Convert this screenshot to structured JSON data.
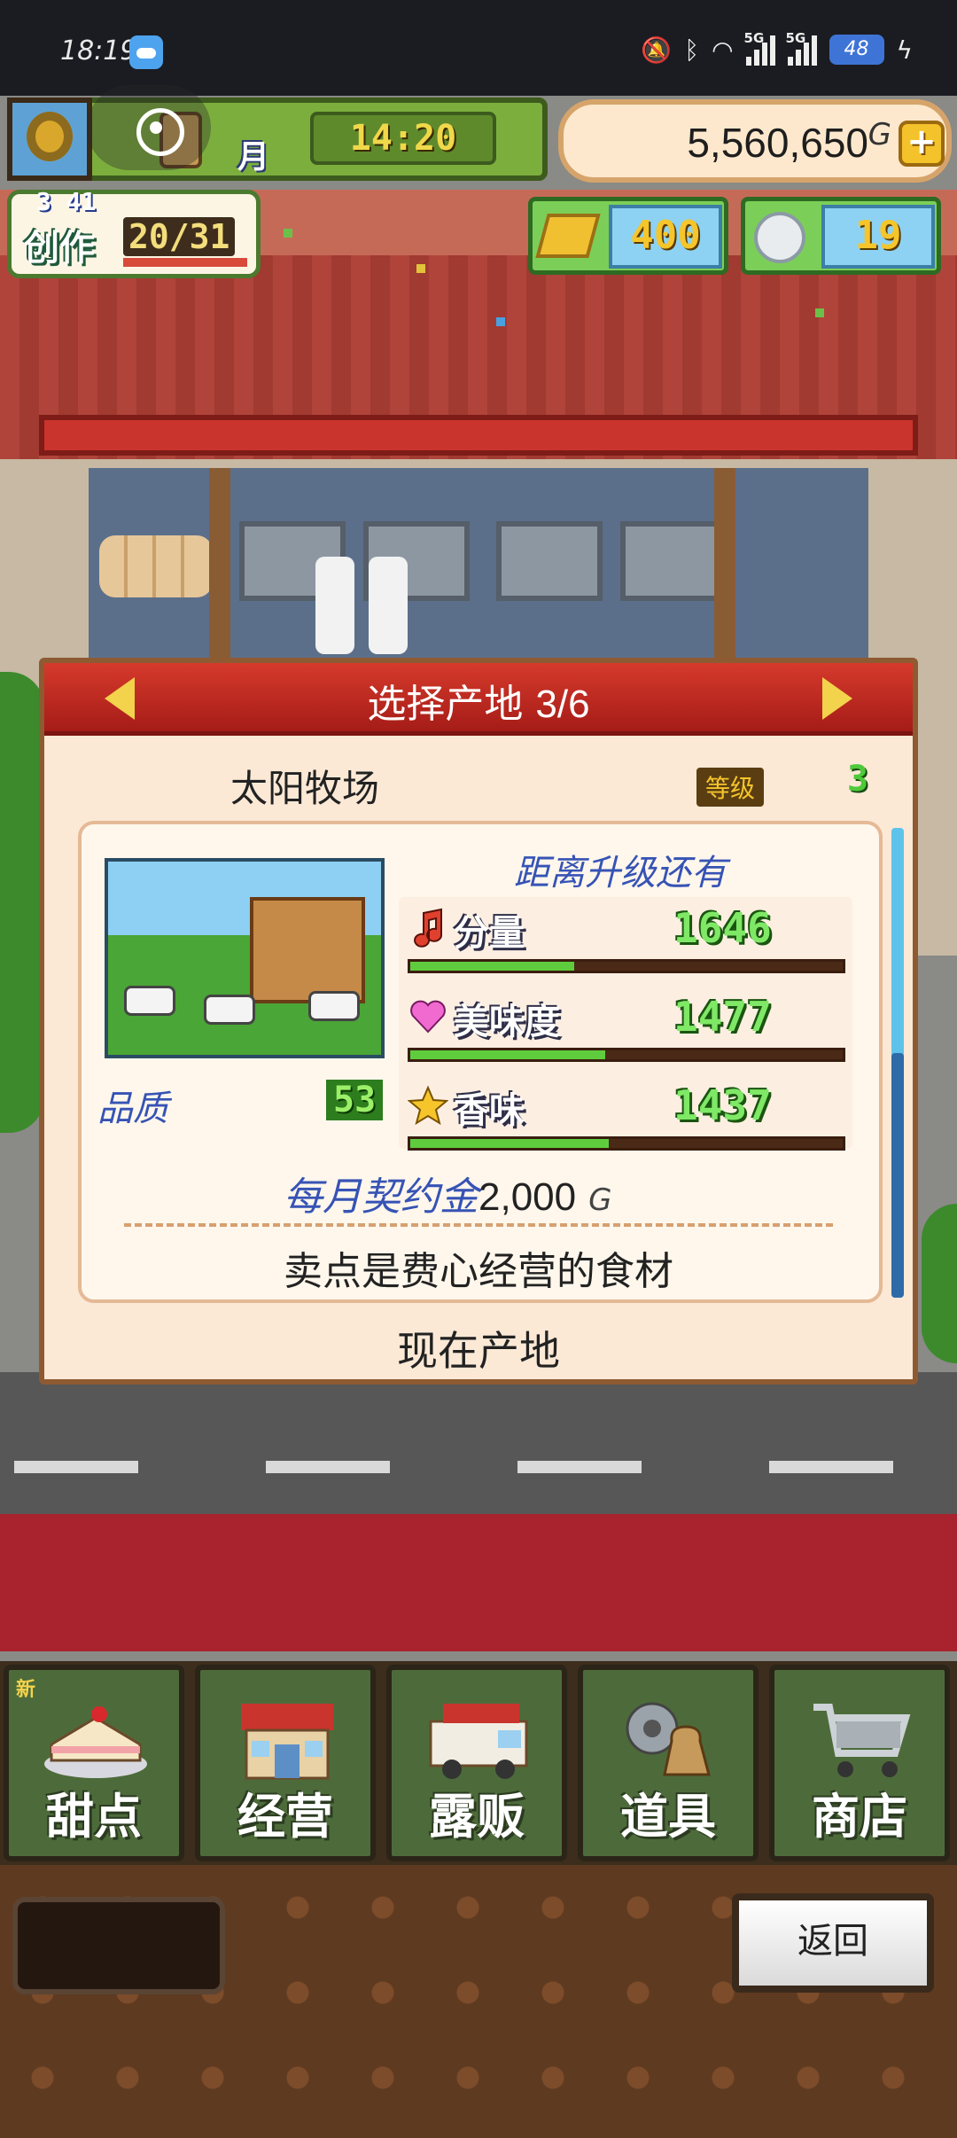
{
  "status_bar": {
    "time": "18:19",
    "network_1": "5G",
    "network_2": "5G",
    "battery": "48",
    "icons": [
      "weather-icon",
      "mute-icon",
      "bluetooth-icon",
      "wifi-icon",
      "signal-icon",
      "signal-icon",
      "battery-icon",
      "charging-icon"
    ]
  },
  "hud": {
    "month_label": "月",
    "clock": "14:20",
    "money": "5,560,650",
    "money_unit": "G",
    "plus": "+",
    "create_label": "创作",
    "create_rank": "3 41",
    "create_count": "20/31",
    "gold_count": "400",
    "medal_count": "19"
  },
  "dialog": {
    "title": "选择产地",
    "page": "3/6",
    "farm_name": "太阳牧场",
    "level_tag": "等级",
    "level": "3",
    "upgrade_label": "距离升级还有",
    "quality_label": "品质",
    "quality_value": "53",
    "stats": [
      {
        "name": "分量",
        "value": "1646",
        "icon": "music-note-icon",
        "progress": 0.38
      },
      {
        "name": "美味度",
        "value": "1477",
        "icon": "heart-icon",
        "progress": 0.45
      },
      {
        "name": "香味",
        "value": "1437",
        "icon": "star-icon",
        "progress": 0.46
      }
    ],
    "fee_label": "每月契约金",
    "fee_value": "2,000",
    "fee_unit": "G",
    "description": "卖点是费心经营的食材",
    "current_label": "现在产地"
  },
  "menu": {
    "items": [
      {
        "label": "甜点",
        "icon": "cake-icon",
        "new": "新"
      },
      {
        "label": "经营",
        "icon": "shop-icon"
      },
      {
        "label": "露贩",
        "icon": "food-truck-icon"
      },
      {
        "label": "道具",
        "icon": "item-bag-icon"
      },
      {
        "label": "商店",
        "icon": "shopping-cart-icon"
      }
    ]
  },
  "back_button": "返回",
  "colors": {
    "dialog_header": "#c42a22",
    "stat_bar": "#5fcc3e",
    "menu_button": "#4d6b3a",
    "carpet": "#a8232d"
  }
}
